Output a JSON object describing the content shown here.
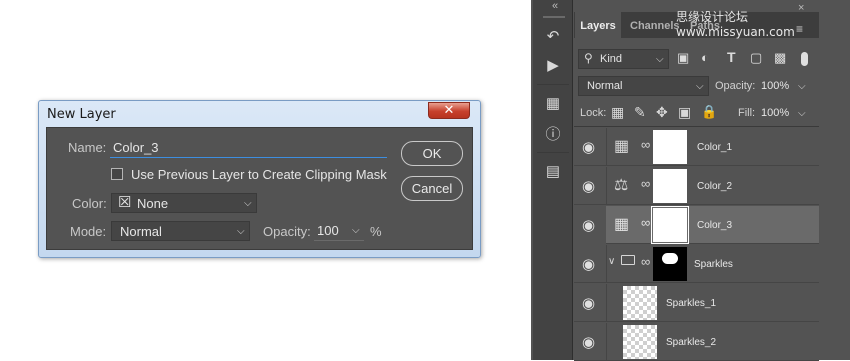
{
  "dialog": {
    "title": "New Layer",
    "close_glyph": "✕",
    "name_label": "Name:",
    "name_value": "Color_3",
    "clip_label": "Use Previous Layer to Create Clipping Mask",
    "color_label": "Color:",
    "color_icon": "☒",
    "color_value": "None",
    "mode_label": "Mode:",
    "mode_value": "Normal",
    "opacity_label": "Opacity:",
    "opacity_value": "100",
    "percent": "%",
    "ok_label": "OK",
    "cancel_label": "Cancel"
  },
  "toolbar": {
    "collapse_glyph": "«",
    "icons": [
      "history-icon",
      "play-action-icon",
      "libraries-icon",
      "info-icon",
      "clone-source-icon"
    ]
  },
  "panel": {
    "tabs": [
      "Layers",
      "Channels",
      "Paths"
    ],
    "close_glyph": "×",
    "kind_label": "Kind",
    "blend_mode": "Normal",
    "opacity_label": "Opacity:",
    "opacity_value": "100%",
    "lock_label": "Lock:",
    "fill_label": "Fill:",
    "fill_value": "100%",
    "watermark": "思缘设计论坛 www.missyuan.com"
  },
  "layers": [
    {
      "name": "Color_1",
      "type": "fill-adjustment",
      "selected": false
    },
    {
      "name": "Color_2",
      "type": "balance-adjustment",
      "selected": false
    },
    {
      "name": "Color_3",
      "type": "fill-adjustment",
      "selected": true
    },
    {
      "name": "Sparkles",
      "type": "group",
      "selected": false
    },
    {
      "name": "Sparkles_1",
      "type": "pixel",
      "selected": false
    },
    {
      "name": "Sparkles_2",
      "type": "pixel",
      "selected": false
    }
  ]
}
